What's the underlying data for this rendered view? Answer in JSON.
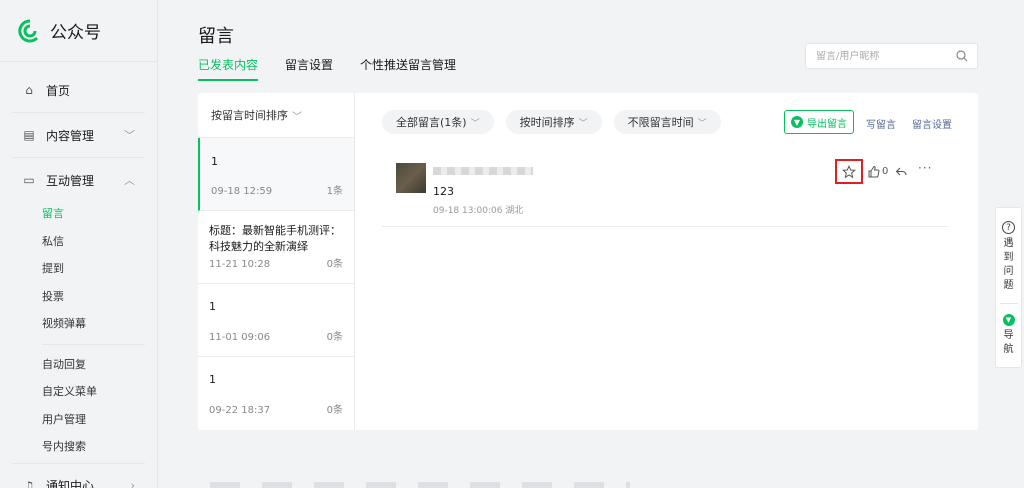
{
  "brand": {
    "name": "公众号",
    "color": "#07c160"
  },
  "sidebar": {
    "items": [
      {
        "label": "首页",
        "icon": "home-icon"
      },
      {
        "label": "内容管理",
        "icon": "document-icon"
      },
      {
        "label": "互动管理",
        "icon": "message-icon"
      }
    ],
    "sub_items": [
      "留言",
      "私信",
      "提到",
      "投票",
      "视频弹幕"
    ],
    "sub_items2": [
      "自动回复",
      "自定义菜单",
      "用户管理",
      "号内搜索"
    ],
    "notify": {
      "label": "通知中心",
      "icon": "bell-icon"
    }
  },
  "header": {
    "title": "留言",
    "tabs": [
      "已发表内容",
      "留言设置",
      "个性推送留言管理"
    ],
    "search_placeholder": "留言/用户昵称"
  },
  "articles": {
    "sort_label": "按留言时间排序",
    "items": [
      {
        "title": "1",
        "date": "09-18 12:59",
        "count": "1条"
      },
      {
        "title": "标题：最新智能手机测评：科技魅力的全新演绎",
        "date": "11-21 10:28",
        "count": "0条"
      },
      {
        "title": "1",
        "date": "11-01 09:06",
        "count": "0条"
      },
      {
        "title": "1",
        "date": "09-22 18:37",
        "count": "0条"
      }
    ]
  },
  "filters": [
    "全部留言(1条)",
    "按时间排序",
    "不限留言时间"
  ],
  "actions": {
    "export": "导出留言",
    "write": "写留言",
    "settings": "留言设置"
  },
  "comment": {
    "text": "123",
    "meta": "09-18 13:00:06 湖北",
    "likes": "0"
  },
  "float": {
    "help": "遇到问题",
    "nav": "导航"
  }
}
